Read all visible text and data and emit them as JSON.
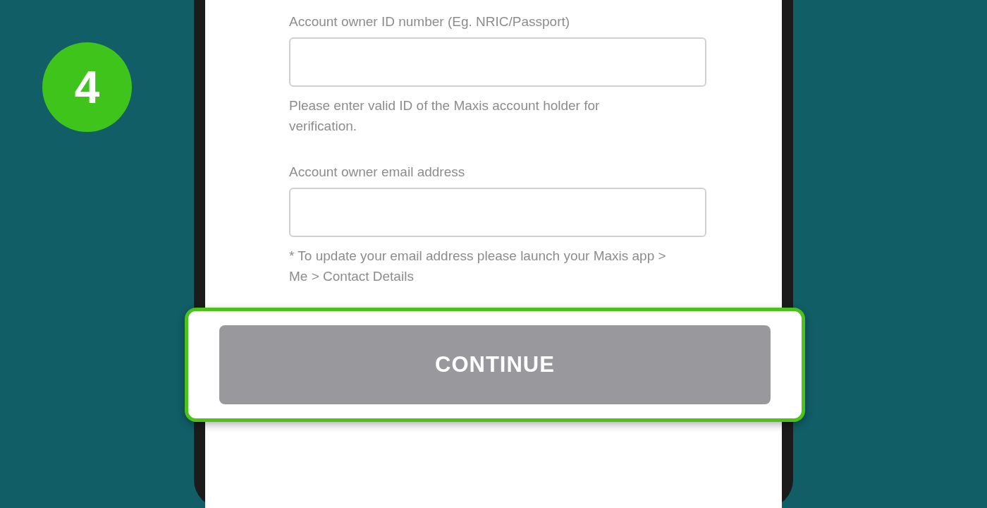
{
  "step_badge": "4",
  "fields": [
    {
      "label": "Account owner ID number (Eg. NRIC/Passport)",
      "hint": "Please enter valid ID of the Maxis account holder for verification."
    },
    {
      "label": "Account owner email address",
      "hint": "* To update your email address please launch your Maxis app > Me > Contact Details"
    }
  ],
  "continue_button": {
    "label": "CONTINUE",
    "disabled": true,
    "highlighted": true
  }
}
